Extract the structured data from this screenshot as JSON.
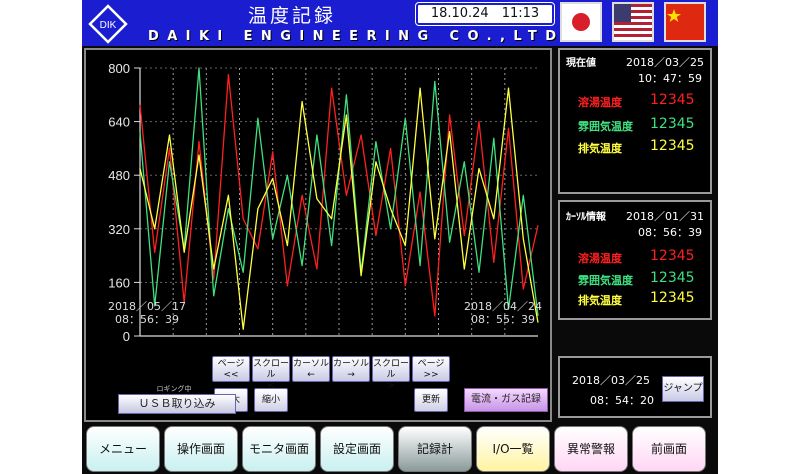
{
  "header": {
    "logo": "DIK",
    "title": "温度記録",
    "company": "DAIKI ENGINEERING CO.,LTD",
    "clock": "18.10.24　11:13",
    "flags": [
      "japan-flag-icon",
      "usa-flag-icon",
      "china-flag-icon"
    ]
  },
  "colors": {
    "red": "#ff2020",
    "green": "#40e080",
    "yellow": "#ffff40",
    "header_blue": "#1a1ed0"
  },
  "chart_data": {
    "type": "line",
    "ylim": [
      0,
      800
    ],
    "yticks": [
      0,
      160,
      320,
      480,
      640,
      800
    ],
    "x_start": "2018／05／17 08：56：39",
    "x_end": "2018／04／24 08：55：39",
    "series": [
      {
        "color": "#ff2020",
        "values": [
          690,
          250,
          560,
          100,
          580,
          170,
          780,
          350,
          260,
          550,
          150,
          420,
          200,
          740,
          420,
          600,
          300,
          560,
          150,
          430,
          60,
          660,
          300,
          640,
          220,
          620,
          140,
          330
        ]
      },
      {
        "color": "#40e080",
        "values": [
          610,
          90,
          520,
          260,
          800,
          120,
          380,
          190,
          650,
          290,
          480,
          210,
          600,
          270,
          720,
          190,
          580,
          320,
          650,
          210,
          760,
          280,
          520,
          190,
          590,
          80,
          420,
          60
        ]
      },
      {
        "color": "#ffff40",
        "values": [
          500,
          320,
          600,
          250,
          540,
          200,
          420,
          20,
          380,
          470,
          270,
          700,
          410,
          350,
          660,
          180,
          520,
          380,
          270,
          740,
          290,
          610,
          200,
          500,
          350,
          740,
          290,
          40
        ]
      }
    ]
  },
  "nav": {
    "page_prev": [
      "ページ",
      "<<"
    ],
    "scroll_prev": [
      "スクロール",
      "<"
    ],
    "cursor_prev": [
      "カーソル",
      "←"
    ],
    "cursor_next": [
      "カーソル",
      "→"
    ],
    "scroll_next": [
      "スクロール",
      ">"
    ],
    "page_next": [
      "ページ",
      ">>"
    ],
    "zoom_in": "拡大",
    "zoom_out": "縮小",
    "update": "更新",
    "left_date": "2018／05／17",
    "left_time": "08：56：39",
    "right_date": "2018／04／24",
    "right_time": "08：55：39",
    "logging": "ロギング中",
    "usb": "ＵＳＢ取り込み",
    "gas": "電流・ガス記録"
  },
  "current": {
    "title": "現在値",
    "date": "2018／03／25",
    "time": "10：47：59",
    "rows": [
      {
        "label": "溶湯温度",
        "value": "12345"
      },
      {
        "label": "雰囲気温度",
        "value": "12345"
      },
      {
        "label": "排気温度",
        "value": "12345"
      }
    ]
  },
  "cursor": {
    "title": "ｶｰｿﾙ情報",
    "date": "2018／01／31",
    "time": "08：56：39",
    "rows": [
      {
        "label": "溶湯温度",
        "value": "12345"
      },
      {
        "label": "雰囲気温度",
        "value": "12345"
      },
      {
        "label": "排気温度",
        "value": "12345"
      }
    ]
  },
  "jump": {
    "date": "2018／03／25",
    "time": "08：54：20",
    "button": "ジャンプ"
  },
  "tabs": [
    {
      "label": "メニュー",
      "bg": "#c8f0f0"
    },
    {
      "label": "操作画面",
      "bg": "#c8f0f0"
    },
    {
      "label": "モニタ画面",
      "bg": "#c8f0f0"
    },
    {
      "label": "設定画面",
      "bg": "#c8f0f0"
    },
    {
      "label": "記録計",
      "bg": "#8a9a9a"
    },
    {
      "label": "I/O一覧",
      "bg": "#fff4a0"
    },
    {
      "label": "異常警報",
      "bg": "#ffd6f4"
    },
    {
      "label": "前画面",
      "bg": "#ffd6f4"
    }
  ]
}
